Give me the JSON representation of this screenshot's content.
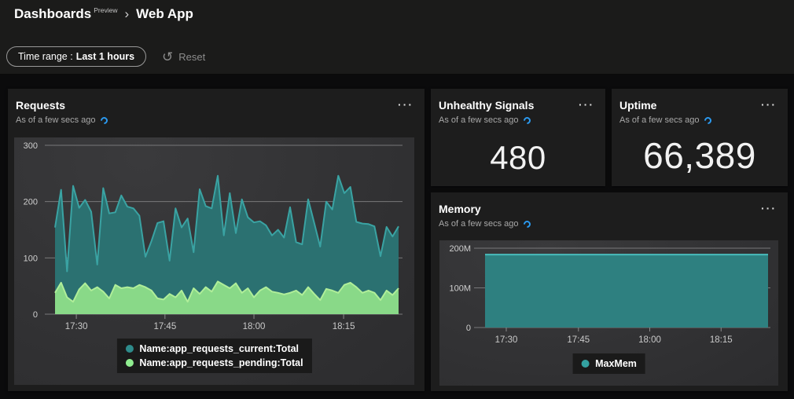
{
  "header": {
    "breadcrumb_root": "Dashboards",
    "preview_badge": "Preview",
    "breadcrumb_current": "Web App"
  },
  "toolbar": {
    "time_range_label": "Time range :",
    "time_range_value": "Last 1 hours",
    "reset_label": "Reset"
  },
  "icons": {
    "ellipsis": "···",
    "reset": "↺",
    "chevron": "›"
  },
  "colors": {
    "accent_blue": "#2b9af0",
    "header_bg": "#1b1b1a",
    "page_bg": "#0b0b0c",
    "card_bg": "#1d1d1d",
    "plot_bg": "#323234",
    "gridline": "#78787a",
    "axis_label": "#cfcfcf"
  },
  "cards": {
    "requests": {
      "title": "Requests",
      "as_of": "As of a few secs ago"
    },
    "unhealthy": {
      "title": "Unhealthy Signals",
      "as_of": "As of a few secs ago",
      "value": "480"
    },
    "uptime": {
      "title": "Uptime",
      "as_of": "As of a few secs ago",
      "value": "66,389"
    },
    "memory": {
      "title": "Memory",
      "as_of": "As of a few secs ago"
    }
  },
  "chart_data": [
    {
      "id": "requests",
      "type": "area",
      "title": "Requests",
      "xlabel": "",
      "ylabel": "",
      "grid": true,
      "legend_position": "bottom-center",
      "ylim": [
        0,
        300
      ],
      "y_ticks": [
        {
          "v": 0,
          "label": "0"
        },
        {
          "v": 100,
          "label": "100"
        },
        {
          "v": 200,
          "label": "200"
        },
        {
          "v": 300,
          "label": "300"
        }
      ],
      "x_ticks": [
        {
          "label": "17:30",
          "pos": 0.062
        },
        {
          "label": "17:45",
          "pos": 0.32
        },
        {
          "label": "18:00",
          "pos": 0.579
        },
        {
          "label": "18:15",
          "pos": 0.84
        }
      ],
      "x_interval_minutes": 1,
      "series": [
        {
          "name": "Name:app_requests_current:Total",
          "line": "#3aa3a3",
          "fill": "#2b7171",
          "dot": "#2e8b8b",
          "values": [
            154,
            221,
            76,
            228,
            189,
            203,
            182,
            88,
            224,
            179,
            181,
            211,
            191,
            188,
            175,
            102,
            130,
            162,
            165,
            95,
            188,
            154,
            170,
            110,
            222,
            192,
            188,
            246,
            140,
            215,
            144,
            204,
            172,
            163,
            165,
            158,
            140,
            150,
            136,
            190,
            128,
            124,
            204,
            162,
            120,
            200,
            186,
            246,
            215,
            226,
            164,
            161,
            160,
            156,
            103,
            155,
            138,
            156
          ]
        },
        {
          "name": "Name:app_requests_pending:Total",
          "line": "#b0ee99",
          "fill": "#89d988",
          "dot": "#90ee90",
          "values": [
            38,
            56,
            30,
            22,
            44,
            55,
            42,
            48,
            40,
            28,
            52,
            46,
            48,
            46,
            52,
            48,
            42,
            28,
            26,
            36,
            30,
            42,
            22,
            46,
            36,
            48,
            40,
            58,
            52,
            46,
            55,
            38,
            46,
            30,
            42,
            48,
            40,
            38,
            35,
            38,
            42,
            34,
            48,
            36,
            25,
            45,
            42,
            38,
            52,
            56,
            48,
            38,
            42,
            38,
            25,
            42,
            34,
            46
          ]
        }
      ]
    },
    {
      "id": "memory",
      "type": "area",
      "title": "Memory",
      "xlabel": "",
      "ylabel": "",
      "grid": true,
      "legend_position": "bottom-center",
      "ylim": [
        0,
        200
      ],
      "y_ticks": [
        {
          "v": 0,
          "label": "0"
        },
        {
          "v": 100,
          "label": "100M"
        },
        {
          "v": 200,
          "label": "200M"
        }
      ],
      "x_ticks": [
        {
          "label": "17:30",
          "pos": 0.075
        },
        {
          "label": "17:45",
          "pos": 0.33
        },
        {
          "label": "18:00",
          "pos": 0.582
        },
        {
          "label": "18:15",
          "pos": 0.834
        }
      ],
      "series": [
        {
          "name": "MaxMem",
          "line": "#48bcbc",
          "fill": "#2e8080",
          "dot": "#34a2a2",
          "values": [
            184,
            184
          ]
        }
      ]
    }
  ]
}
